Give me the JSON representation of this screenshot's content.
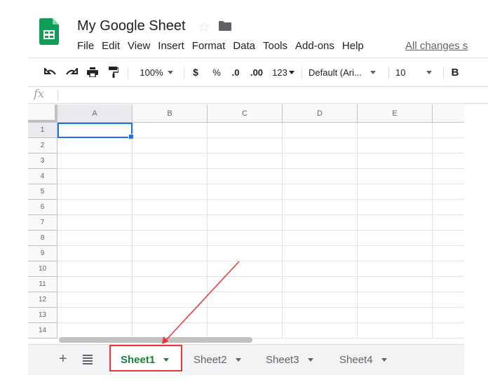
{
  "header": {
    "title": "My Google Sheet",
    "all_changes": "All changes s",
    "icons": {
      "logo": "sheets-logo-icon",
      "star": "star-icon",
      "folder": "folder-icon"
    }
  },
  "menu": [
    "File",
    "Edit",
    "View",
    "Insert",
    "Format",
    "Data",
    "Tools",
    "Add-ons",
    "Help"
  ],
  "toolbar": {
    "zoom": "100%",
    "currency": "$",
    "percent": "%",
    "decrease_decimal": ".0",
    "increase_decimal": ".00",
    "more_formats": "123",
    "font": "Default (Ari...",
    "font_size": "10",
    "bold": "B"
  },
  "formula_bar": {
    "label": "fx",
    "value": ""
  },
  "grid": {
    "columns": [
      "A",
      "B",
      "C",
      "D",
      "E"
    ],
    "rows": [
      "1",
      "2",
      "3",
      "4",
      "5",
      "6",
      "7",
      "8",
      "9",
      "10",
      "11",
      "12",
      "13",
      "14"
    ],
    "selected_cell": "A1"
  },
  "sheets": {
    "add_label": "+",
    "tabs": [
      {
        "label": "Sheet1",
        "active": true
      },
      {
        "label": "Sheet2",
        "active": false
      },
      {
        "label": "Sheet3",
        "active": false
      },
      {
        "label": "Sheet4",
        "active": false
      }
    ]
  },
  "colors": {
    "active_tab": "#188038",
    "selection": "#1a73e8",
    "annotation": "#e53935",
    "logo": "#0f9d58"
  }
}
